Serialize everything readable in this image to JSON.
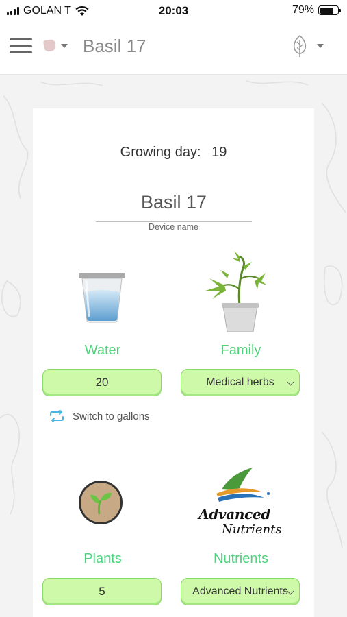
{
  "status_bar": {
    "carrier": "GOLAN T",
    "time": "20:03",
    "battery": "79%",
    "battery_level": 0.79
  },
  "header": {
    "title": "Basil 17",
    "menu_icon": "hamburger-icon",
    "plant_icon": "pot-icon",
    "leaf_icon": "leaf-icon"
  },
  "card": {
    "growing_day_label": "Growing day:",
    "growing_day_value": "19",
    "device_name_value": "Basil 17",
    "device_name_caption": "Device name"
  },
  "water": {
    "label": "Water",
    "value": "20",
    "switch_label": "Switch to gallons"
  },
  "family": {
    "label": "Family",
    "value": "Medical herbs"
  },
  "plants": {
    "label": "Plants",
    "value": "5"
  },
  "nutrients": {
    "label": "Nutrients",
    "value": "Advanced Nutrients",
    "logo_line1": "Advanced",
    "logo_line2": "Nutrients"
  },
  "colors": {
    "accent_green": "#4dd37c",
    "field_green": "#cdf9a8",
    "switch_blue": "#4ab6e0"
  }
}
